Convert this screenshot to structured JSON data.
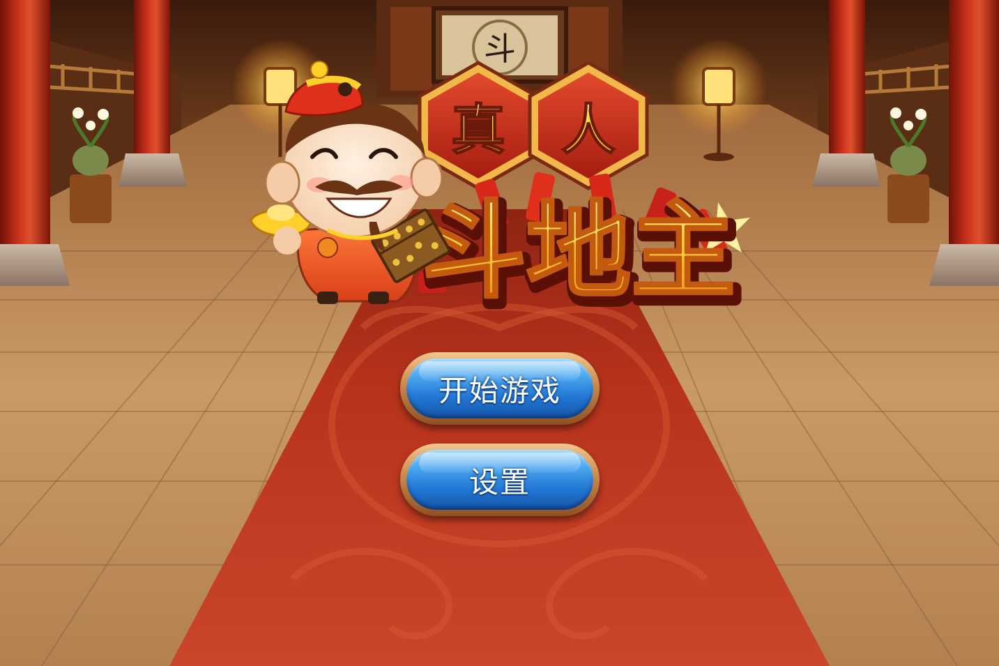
{
  "game": {
    "logo": {
      "badge_char_1": "真",
      "badge_char_2": "人",
      "title": "斗地主",
      "palace_plaque": "斗"
    },
    "menu": {
      "start_label": "开始游戏",
      "settings_label": "设置"
    }
  },
  "colors": {
    "carpet": "#b8331c",
    "button_blue": "#2f8de4",
    "button_rim": "#c98a4a",
    "logo_gold": "#ffd23a",
    "badge_red": "#c7301d"
  }
}
